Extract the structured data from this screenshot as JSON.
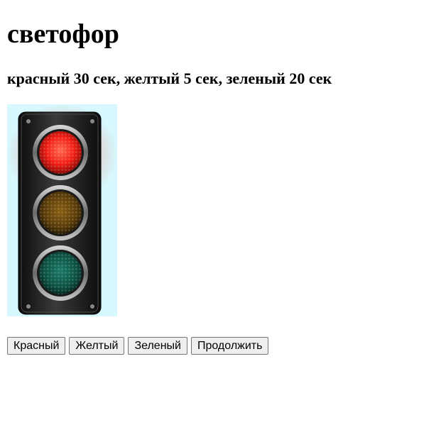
{
  "page": {
    "title": "светофор",
    "subtitle": "красный 30 сек, желтый 5 сек, зеленый 20 сек"
  },
  "traffic_light": {
    "colors": {
      "background": "#d6f8fe",
      "housing": "#1c1c1c",
      "red_lamp": "#ff2a1a",
      "yellow_lamp": "#6b4a0a",
      "green_lamp": "#0e5c4c"
    }
  },
  "buttons": {
    "red_label": "Красный",
    "yellow_label": "Желтый",
    "green_label": "Зеленый",
    "continue_label": "Продолжить"
  }
}
